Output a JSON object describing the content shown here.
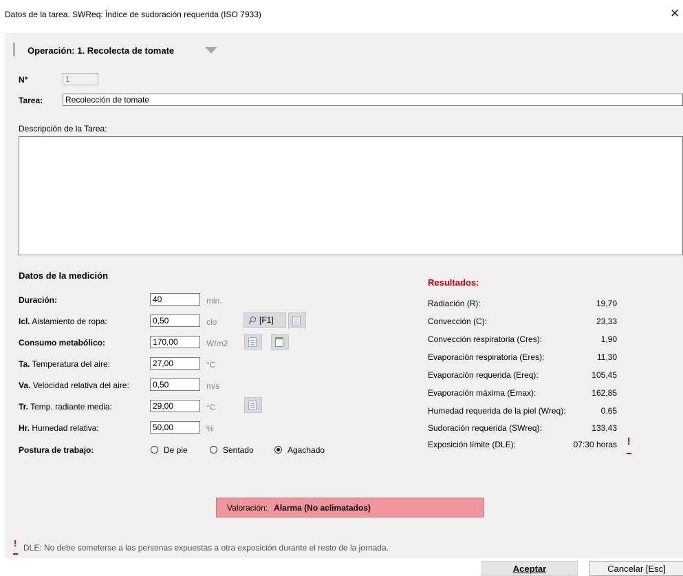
{
  "window": {
    "title": "Datos de la tarea. SWReq: Índice de sudoración requerida (ISO 7933)",
    "close_icon": "close-icon"
  },
  "operation": {
    "title": "Operación: 1. Recolecta de tomate"
  },
  "task": {
    "number_label": "Nº",
    "number_value": "1",
    "name_label": "Tarea:",
    "name_value": "Recolección de tomate",
    "description_label": "Descripción de la Tarea:",
    "description_value": ""
  },
  "measurement": {
    "heading": "Datos de la medición",
    "rows": [
      {
        "label_bold": "Duración:",
        "label_rest": "",
        "value": "40",
        "unit": "min."
      },
      {
        "label_bold": "Icl.",
        "label_rest": " Aislamiento de ropa:",
        "value": "0,50",
        "unit": "clo"
      },
      {
        "label_bold": "Consumo metabólico:",
        "label_rest": "",
        "value": "170,00",
        "unit": "W/m2"
      },
      {
        "label_bold": "Ta.",
        "label_rest": " Temperatura del aire:",
        "value": "27,00",
        "unit": "°C"
      },
      {
        "label_bold": "Va.",
        "label_rest": " Velocidad relativa del aire:",
        "value": "0,50",
        "unit": "m/s"
      },
      {
        "label_bold": "Tr.",
        "label_rest": " Temp. radiante media:",
        "value": "29,00",
        "unit": "°C"
      },
      {
        "label_bold": "Hr.",
        "label_rest": " Humedad relativa:",
        "value": "50,00",
        "unit": "%"
      }
    ],
    "f1_label": "[F1]",
    "posture_label": "Postura de trabajo:",
    "posture_options": [
      "De pie",
      "Sentado",
      "Agachado"
    ],
    "posture_selected": "Agachado"
  },
  "results": {
    "heading": "Resultados:",
    "items": [
      {
        "label": "Radiación (R):",
        "value": "19,70"
      },
      {
        "label": "Convección (C):",
        "value": "23,33"
      },
      {
        "label": "Convección respiratoria (Cres):",
        "value": "1,90"
      },
      {
        "label": "Evaporación respiratoria (Eres):",
        "value": "11,30"
      },
      {
        "label": "Evaporación requerida (Ereq):",
        "value": "105,45"
      },
      {
        "label": "Evaporación máxima (Emax):",
        "value": "162,85"
      },
      {
        "label": "Humedad requerida de la piel (Wreq):",
        "value": "0,65"
      },
      {
        "label": "Sudoración requerida (SWreq):",
        "value": "133,43"
      },
      {
        "label": "Exposición límite (DLE):",
        "value": "07:30 horas"
      }
    ]
  },
  "assessment": {
    "label": "Valoración:",
    "value": "Alarma (No aclimatados)",
    "color": "#f0959b"
  },
  "footnote": {
    "text": "DLE: No debe someterse a las personas expuestas a otra exposición durante el resto de la jornada."
  },
  "buttons": {
    "accept": "Aceptar",
    "cancel": "Cancelar  [Esc]"
  },
  "colors": {
    "alarm_red": "#d00000",
    "results_heading": "#c40000",
    "operation_bar": "#8fc58f"
  }
}
